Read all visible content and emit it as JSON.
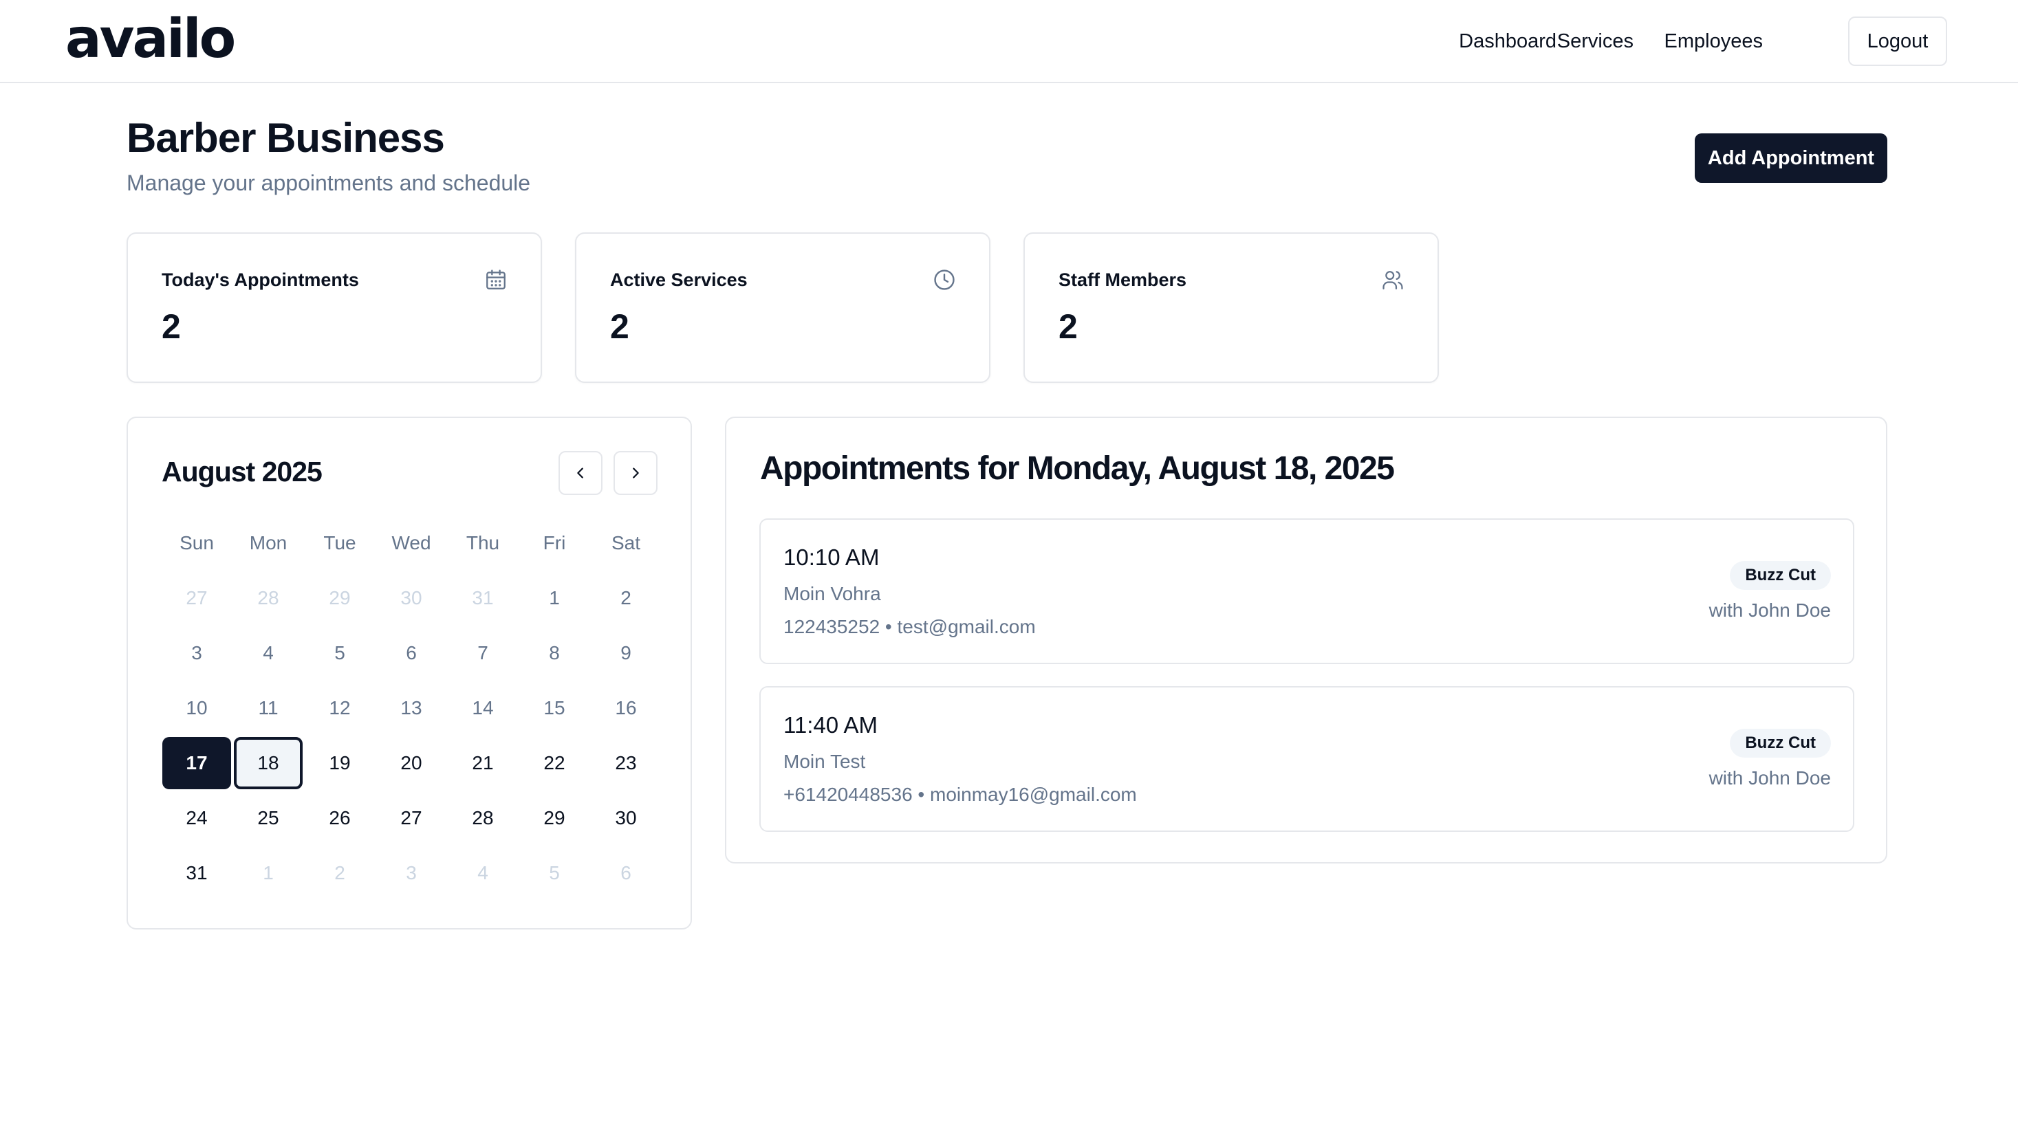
{
  "app": {
    "logo": "availo"
  },
  "nav": {
    "dashboard": "Dashboard",
    "services": "Services",
    "employees": "Employees",
    "logout": "Logout"
  },
  "header": {
    "title": "Barber Business",
    "subtitle": "Manage your appointments and schedule",
    "add_button": "Add Appointment"
  },
  "stats": [
    {
      "label": "Today's Appointments",
      "value": "2",
      "icon": "calendar-icon"
    },
    {
      "label": "Active Services",
      "value": "2",
      "icon": "clock-icon"
    },
    {
      "label": "Staff Members",
      "value": "2",
      "icon": "users-icon"
    }
  ],
  "calendar": {
    "month_label": "August 2025",
    "weekdays": [
      "Sun",
      "Mon",
      "Tue",
      "Wed",
      "Thu",
      "Fri",
      "Sat"
    ],
    "today": "17",
    "selected": "18",
    "weeks": [
      [
        {
          "d": "27",
          "s": "outside"
        },
        {
          "d": "28",
          "s": "outside"
        },
        {
          "d": "29",
          "s": "outside"
        },
        {
          "d": "30",
          "s": "outside"
        },
        {
          "d": "31",
          "s": "outside"
        },
        {
          "d": "1",
          "s": "past"
        },
        {
          "d": "2",
          "s": "past"
        }
      ],
      [
        {
          "d": "3",
          "s": "past"
        },
        {
          "d": "4",
          "s": "past"
        },
        {
          "d": "5",
          "s": "past"
        },
        {
          "d": "6",
          "s": "past"
        },
        {
          "d": "7",
          "s": "past"
        },
        {
          "d": "8",
          "s": "past"
        },
        {
          "d": "9",
          "s": "past"
        }
      ],
      [
        {
          "d": "10",
          "s": "past"
        },
        {
          "d": "11",
          "s": "past"
        },
        {
          "d": "12",
          "s": "past"
        },
        {
          "d": "13",
          "s": "past"
        },
        {
          "d": "14",
          "s": "past"
        },
        {
          "d": "15",
          "s": "past"
        },
        {
          "d": "16",
          "s": "past"
        }
      ],
      [
        {
          "d": "17",
          "s": "today"
        },
        {
          "d": "18",
          "s": "selected"
        },
        {
          "d": "19",
          "s": ""
        },
        {
          "d": "20",
          "s": ""
        },
        {
          "d": "21",
          "s": ""
        },
        {
          "d": "22",
          "s": ""
        },
        {
          "d": "23",
          "s": ""
        }
      ],
      [
        {
          "d": "24",
          "s": ""
        },
        {
          "d": "25",
          "s": ""
        },
        {
          "d": "26",
          "s": ""
        },
        {
          "d": "27",
          "s": ""
        },
        {
          "d": "28",
          "s": ""
        },
        {
          "d": "29",
          "s": ""
        },
        {
          "d": "30",
          "s": ""
        }
      ],
      [
        {
          "d": "31",
          "s": ""
        },
        {
          "d": "1",
          "s": "outside"
        },
        {
          "d": "2",
          "s": "outside"
        },
        {
          "d": "3",
          "s": "outside"
        },
        {
          "d": "4",
          "s": "outside"
        },
        {
          "d": "5",
          "s": "outside"
        },
        {
          "d": "6",
          "s": "outside"
        }
      ]
    ]
  },
  "appointments": {
    "heading": "Appointments for Monday, August 18, 2025",
    "items": [
      {
        "time": "10:10 AM",
        "name": "Moin Vohra",
        "contact": "122435252 • test@gmail.com",
        "service": "Buzz Cut",
        "staff": "with John Doe"
      },
      {
        "time": "11:40 AM",
        "name": "Moin Test",
        "contact": "+61420448536 • moinmay16@gmail.com",
        "service": "Buzz Cut",
        "staff": "with John Doe"
      }
    ]
  },
  "colors": {
    "primary": "#0f172a",
    "muted_text": "#64748b",
    "border": "#e5e7eb",
    "badge_bg": "#f1f5f9"
  }
}
